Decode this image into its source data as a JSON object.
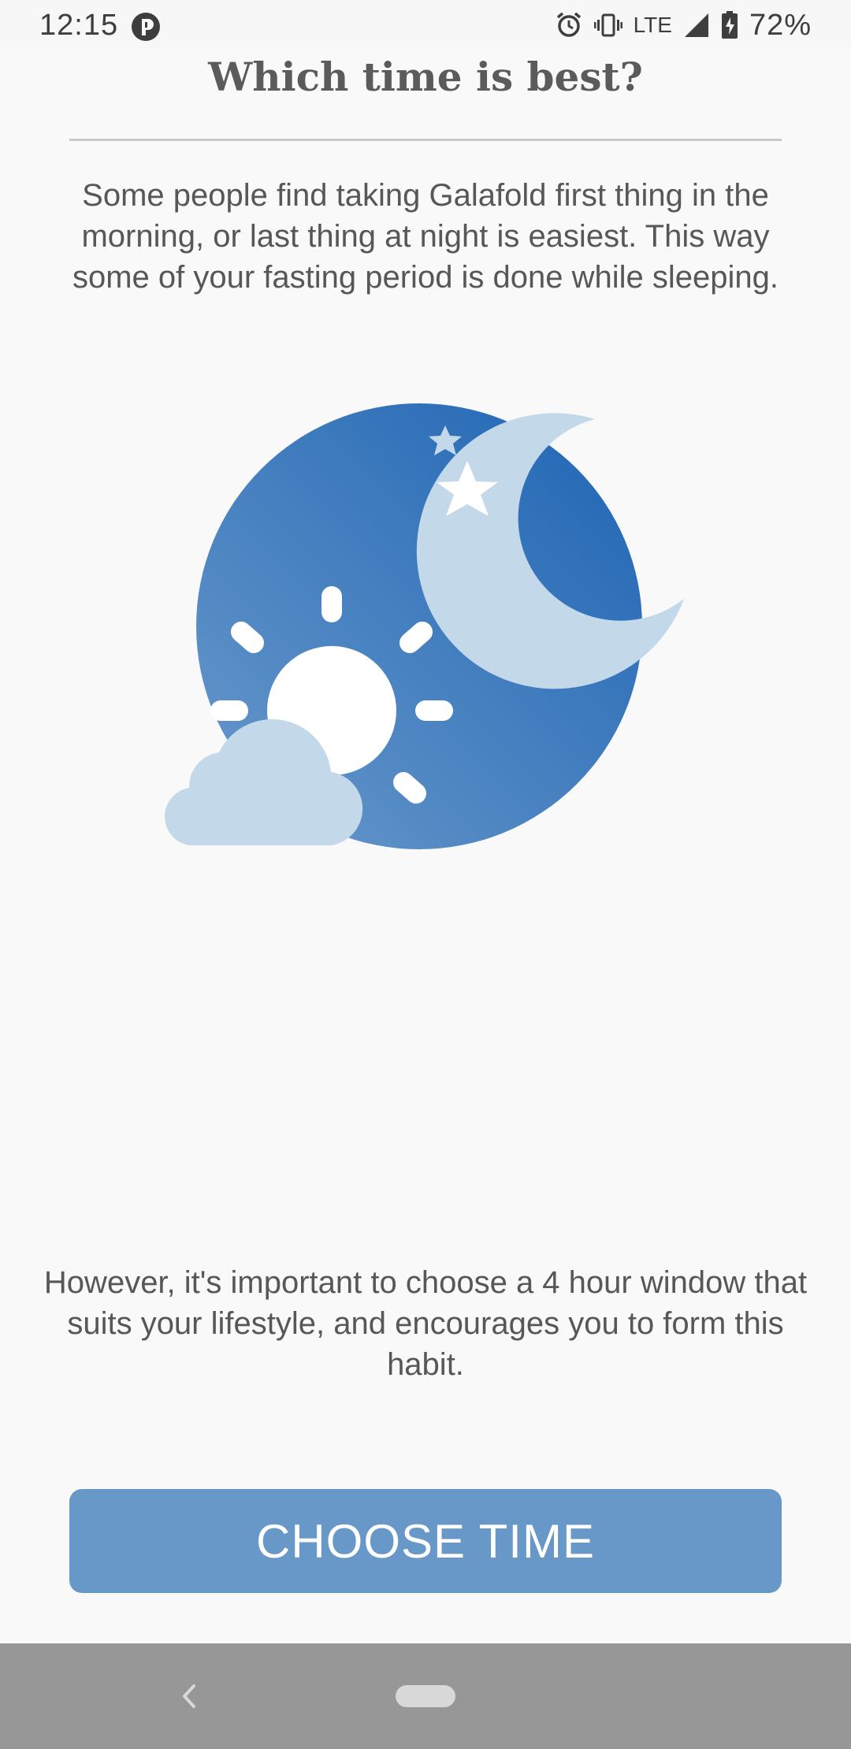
{
  "status_bar": {
    "time": "12:15",
    "network": "LTE",
    "battery": "72%",
    "icons": [
      "app-notification-icon",
      "alarm-icon",
      "vibrate-icon",
      "signal-icon",
      "battery-charging-icon"
    ]
  },
  "page": {
    "title": "Which time is best?",
    "intro": "Some people find taking Galafold first thing in the morning, or last thing at night is easiest. This way some of your fasting period is done while sleeping.",
    "illustration_icon": "day-night-icon",
    "note": "However, it's important to choose a 4 hour window that suits your lifestyle, and encourages you to form this habit.",
    "button_label": "CHOOSE TIME"
  },
  "nav_bar": {
    "icons": [
      "back-icon",
      "home-pill-icon"
    ]
  },
  "colors": {
    "background": "#f9f9fa",
    "button": "#6898c8",
    "circle_dark": "#1e64b4",
    "circle_light": "#6a9acb",
    "moon": "#c3d8e8",
    "cloud": "#c3d8e8",
    "nav_bar": "#979797"
  }
}
